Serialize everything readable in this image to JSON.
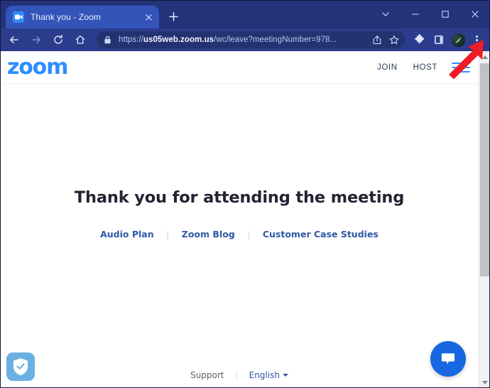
{
  "browser": {
    "tab": {
      "title": "Thank you - Zoom",
      "favicon_icon": "zoom-video-camera-icon",
      "close_icon": "close-icon"
    },
    "new_tab_icon": "plus-icon",
    "window_controls": [
      {
        "name": "tab-search",
        "icon": "chevron-down-icon"
      },
      {
        "name": "minimize",
        "icon": "minimize-icon"
      },
      {
        "name": "maximize",
        "icon": "maximize-icon"
      },
      {
        "name": "close",
        "icon": "close-icon"
      }
    ],
    "toolbar": {
      "back_icon": "back-arrow-icon",
      "forward_icon": "forward-arrow-icon",
      "reload_icon": "reload-icon",
      "home_icon": "home-icon",
      "lock_icon": "lock-icon",
      "url_full": "https://us05web.zoom.us/wc/leave?meetingNumber=978...",
      "url_scheme": "https://",
      "url_host": "us05web.zoom.us",
      "url_path": "/wc/leave?meetingNumber=978...",
      "share_icon": "share-icon",
      "bookmark_icon": "star-icon",
      "extensions_icon": "puzzle-piece-icon",
      "side_panel_icon": "side-panel-icon",
      "profile_icon": "extension-avatar-icon",
      "menu_icon": "three-dot-menu-icon"
    },
    "scrollbar": {
      "up_icon": "scroll-up-arrow-icon",
      "down_icon": "scroll-down-arrow-icon"
    }
  },
  "annotation": {
    "arrow_color": "#ee1c25",
    "target": "chrome-three-dot-menu"
  },
  "page": {
    "header": {
      "logo_text": "zoom",
      "logo_color": "#2d8cff",
      "join_label": "JOIN",
      "host_label": "HOST",
      "menu_icon": "hamburger-menu-icon"
    },
    "heading": "Thank you for attending the meeting",
    "links": [
      {
        "label": "Audio Plan"
      },
      {
        "label": "Zoom Blog"
      },
      {
        "label": "Customer Case Studies"
      }
    ],
    "link_separator": "|",
    "footer": {
      "support_label": "Support",
      "separator": "|",
      "language_label": "English",
      "language_caret_icon": "caret-down-icon"
    },
    "chat_widget": {
      "icon": "chat-bubble-icon",
      "color": "#1667e0"
    },
    "trust_badge": {
      "icon": "shield-check-icon",
      "color": "#6cb0e3"
    }
  }
}
